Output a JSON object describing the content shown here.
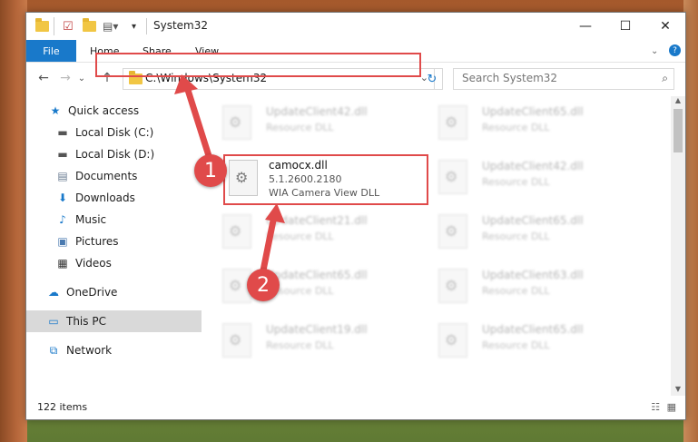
{
  "window": {
    "title": "System32",
    "min_label": "—",
    "max_label": "☐",
    "close_label": "✕"
  },
  "ribbon": {
    "tabs": [
      "File",
      "Home",
      "Share",
      "View"
    ]
  },
  "navigation": {
    "back": "←",
    "forward": "→",
    "recent": "⌄",
    "up": "↑",
    "address": "C:\\Windows\\System32",
    "dropdown": "⌄",
    "refresh": "↻",
    "search_placeholder": "Search System32",
    "search_icon": "⌕"
  },
  "sidebar": {
    "items": [
      {
        "label": "Quick access",
        "icon": "★",
        "pinned": false
      },
      {
        "label": "Local Disk (C:)",
        "icon": "▬",
        "pinned": true
      },
      {
        "label": "Local Disk (D:)",
        "icon": "▬",
        "pinned": true
      },
      {
        "label": "Documents",
        "icon": "▤",
        "pinned": true
      },
      {
        "label": "Downloads",
        "icon": "⬇",
        "pinned": true
      },
      {
        "label": "Music",
        "icon": "♪",
        "pinned": true
      },
      {
        "label": "Pictures",
        "icon": "▣",
        "pinned": true
      },
      {
        "label": "Videos",
        "icon": "▦",
        "pinned": true
      },
      {
        "label": "OneDrive",
        "icon": "☁",
        "pinned": false
      },
      {
        "label": "This PC",
        "icon": "▭",
        "pinned": false
      },
      {
        "label": "Network",
        "icon": "⧉",
        "pinned": false
      }
    ],
    "pin_glyph": "📌"
  },
  "files": {
    "left_column": [
      {
        "name": "UpdateClient42.dll",
        "type": "Resource DLL"
      },
      {
        "name": "UpdateClient21.dll",
        "type": "Resource DLL"
      },
      {
        "name": "UpdateClient65.dll",
        "type": "Resource DLL"
      },
      {
        "name": "UpdateClient19.dll",
        "type": "Resource DLL"
      }
    ],
    "right_column": [
      {
        "name": "UpdateClient65.dll",
        "type": "Resource DLL"
      },
      {
        "name": "UpdateClient42.dll",
        "type": "Resource DLL"
      },
      {
        "name": "UpdateClient65.dll",
        "type": "Resource DLL"
      },
      {
        "name": "UpdateClient63.dll",
        "type": "Resource DLL"
      },
      {
        "name": "UpdateClient65.dll",
        "type": "Resource DLL"
      }
    ],
    "highlighted": {
      "name": "camocx.dll",
      "version": "5.1.2600.2180",
      "description": "WIA Camera View DLL"
    }
  },
  "status": {
    "count": "122 items"
  },
  "markers": {
    "one": "1",
    "two": "2"
  },
  "colors": {
    "accent": "#1979ca",
    "highlight": "#e04a4a"
  }
}
